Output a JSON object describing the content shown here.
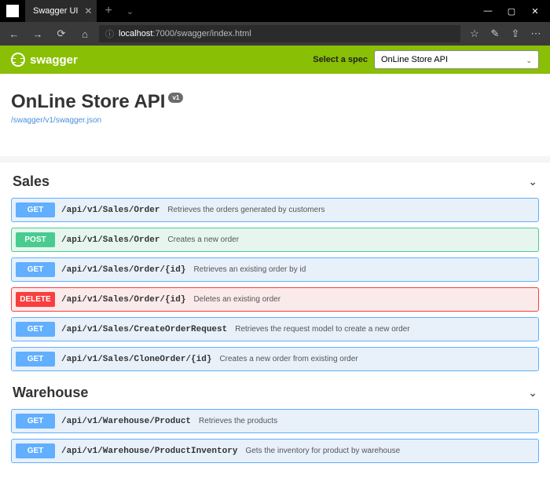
{
  "browser": {
    "tabTitle": "Swagger UI",
    "urlPrefix": "localhost",
    "urlRest": ":7000/swagger/index.html"
  },
  "topbar": {
    "brand": "swagger",
    "selectLabel": "Select a spec",
    "selectedSpec": "OnLine Store API"
  },
  "api": {
    "title": "OnLine Store API",
    "badge": "v1",
    "jsonLink": "/swagger/v1/swagger.json"
  },
  "sections": [
    {
      "name": "Sales",
      "ops": [
        {
          "method": "GET",
          "path": "/api/v1/Sales/Order",
          "desc": "Retrieves the orders generated by customers"
        },
        {
          "method": "POST",
          "path": "/api/v1/Sales/Order",
          "desc": "Creates a new order"
        },
        {
          "method": "GET",
          "path": "/api/v1/Sales/Order/{id}",
          "desc": "Retrieves an existing order by id"
        },
        {
          "method": "DELETE",
          "path": "/api/v1/Sales/Order/{id}",
          "desc": "Deletes an existing order"
        },
        {
          "method": "GET",
          "path": "/api/v1/Sales/CreateOrderRequest",
          "desc": "Retrieves the request model to create a new order"
        },
        {
          "method": "GET",
          "path": "/api/v1/Sales/CloneOrder/{id}",
          "desc": "Creates a new order from existing order"
        }
      ]
    },
    {
      "name": "Warehouse",
      "ops": [
        {
          "method": "GET",
          "path": "/api/v1/Warehouse/Product",
          "desc": "Retrieves the products"
        },
        {
          "method": "GET",
          "path": "/api/v1/Warehouse/ProductInventory",
          "desc": "Gets the inventory for product by warehouse"
        }
      ]
    }
  ]
}
